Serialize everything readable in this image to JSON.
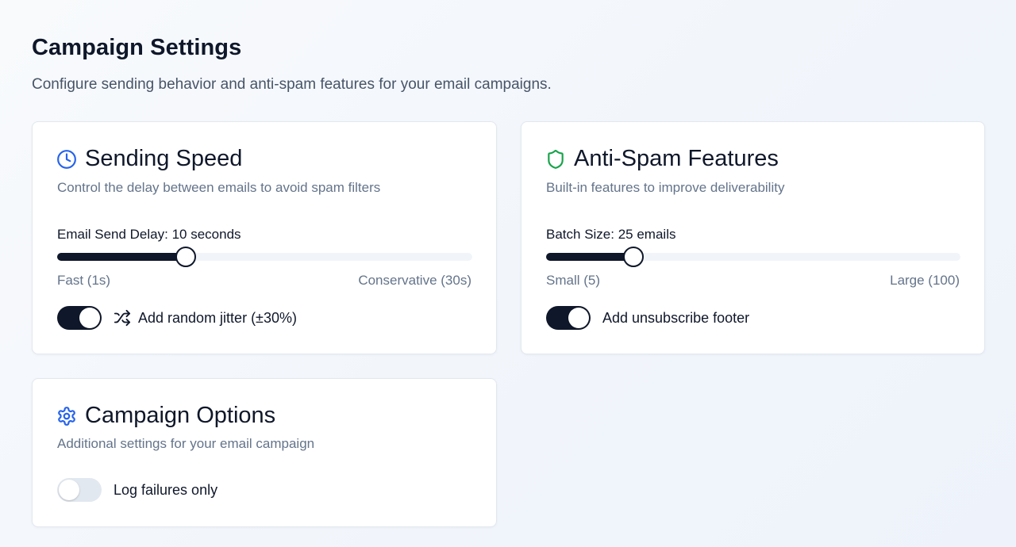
{
  "page": {
    "title": "Campaign Settings",
    "subtitle": "Configure sending behavior and anti-spam features for your email campaigns."
  },
  "sending_speed": {
    "title": "Sending Speed",
    "icon": "clock-icon",
    "icon_color": "#2563eb",
    "description": "Control the delay between emails to avoid spam filters",
    "slider_label": "Email Send Delay: 10 seconds",
    "slider_value_fraction": 0.31,
    "range_min": "Fast (1s)",
    "range_max": "Conservative (30s)",
    "jitter_toggle_on": true,
    "jitter_icon": "shuffle-icon",
    "jitter_label": "Add random jitter (±30%)"
  },
  "anti_spam": {
    "title": "Anti-Spam Features",
    "icon": "shield-icon",
    "icon_color": "#16a34a",
    "description": "Built-in features to improve deliverability",
    "slider_label": "Batch Size: 25 emails",
    "slider_value_fraction": 0.21,
    "range_min": "Small (5)",
    "range_max": "Large (100)",
    "unsubscribe_toggle_on": true,
    "unsubscribe_label": "Add unsubscribe footer"
  },
  "campaign_options": {
    "title": "Campaign Options",
    "icon": "gear-icon",
    "icon_color": "#2563eb",
    "description": "Additional settings for your email campaign",
    "log_failures_toggle_on": false,
    "log_failures_label": "Log failures only"
  },
  "colors": {
    "primary": "#0f172a",
    "muted_text": "#64748b",
    "track": "#f1f5f9"
  }
}
